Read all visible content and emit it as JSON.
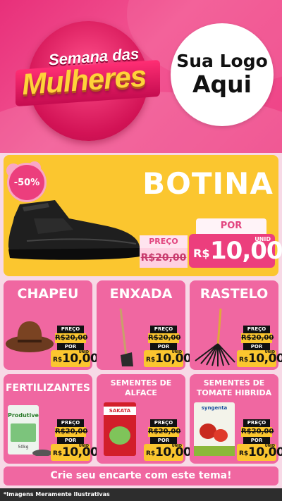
{
  "header": {
    "title_line1": "Semana das",
    "title_line2": "Mulheres",
    "logo_line1": "Sua Logo",
    "logo_line2": "Aqui"
  },
  "main_product": {
    "discount": "-50%",
    "name": "BOTINA",
    "preco_label": "PREÇO",
    "old_price": "R$20,00",
    "por_label": "POR",
    "currency": "R$",
    "price": "10,00",
    "unit": "UNID"
  },
  "products": [
    {
      "name": "CHAPEU",
      "preco_label": "PREÇO",
      "old_price": "R$20,00",
      "por_label": "POR",
      "currency": "R$",
      "price": "10,00",
      "unit": "UNID"
    },
    {
      "name": "ENXADA",
      "preco_label": "PREÇO",
      "old_price": "R$20,00",
      "por_label": "POR",
      "currency": "R$",
      "price": "10,00",
      "unit": "UNID"
    },
    {
      "name": "RASTELO",
      "preco_label": "PREÇO",
      "old_price": "R$20,00",
      "por_label": "POR",
      "currency": "R$",
      "price": "10,00",
      "unit": "UNID"
    },
    {
      "name": "FERTILIZANTES",
      "preco_label": "PREÇO",
      "old_price": "R$20,00",
      "por_label": "POR",
      "currency": "R$",
      "price": "10,00",
      "unit": "UNID",
      "package_brand": "Produtive",
      "package_weight": "50kg"
    },
    {
      "name_line1": "SEMENTES DE",
      "name_line2": "ALFACE",
      "preco_label": "PREÇO",
      "old_price": "R$20,00",
      "por_label": "POR",
      "currency": "R$",
      "price": "10,00",
      "unit": "UNID",
      "package_brand": "SAKATA"
    },
    {
      "name_line1": "SEMENTES DE",
      "name_line2": "TOMATE HIBRIDA",
      "preco_label": "PREÇO",
      "old_price": "R$20,00",
      "por_label": "POR",
      "currency": "R$",
      "price": "10,00",
      "unit": "UNID",
      "package_brand": "syngenta"
    }
  ],
  "cta": "Crie seu encarte com este tema!",
  "footer": "*Imagens Meramente Ilustrativas",
  "colors": {
    "header_pink": "#ee4286",
    "card_pink": "#f067a1",
    "main_yellow": "#fbc62f",
    "price_pink": "#ec3e7d",
    "title_gold": "#ffd33a"
  },
  "icons": [
    "boot-image",
    "hat-image",
    "hoe-image",
    "rake-image",
    "fertilizer-bag-image",
    "lettuce-seed-pack-image",
    "tomato-seed-pack-image"
  ]
}
